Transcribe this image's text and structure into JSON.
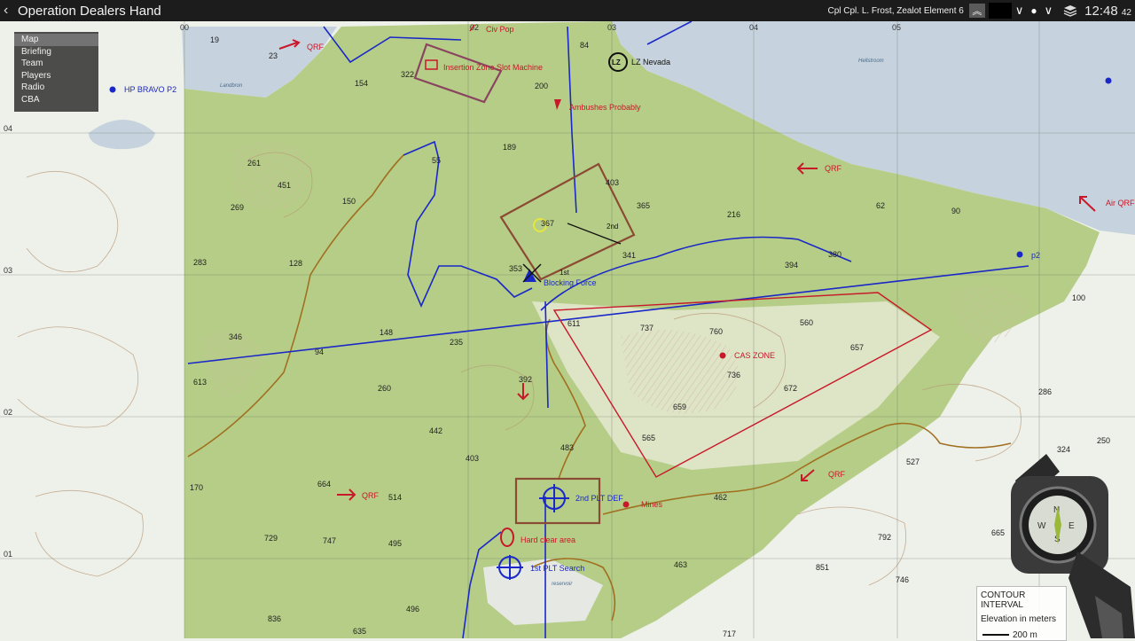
{
  "header": {
    "title": "Operation Dealers Hand",
    "player": "Cpl Cpl. L. Frost, Zealot Element 6",
    "time_main": "12:48",
    "time_sec": "42"
  },
  "menu": {
    "items": [
      "Map",
      "Briefing",
      "Team",
      "Players",
      "Radio",
      "CBA"
    ],
    "selected": "Map"
  },
  "legend": {
    "title": "CONTOUR INTERVAL",
    "subtitle": "Elevation in meters",
    "scale": "200 m"
  },
  "grid": {
    "top": [
      "00",
      "02",
      "03",
      "04",
      "05"
    ],
    "left": [
      "04",
      "03",
      "02",
      "01"
    ]
  },
  "markers": {
    "qrf": "QRF",
    "air_qrf": "Air QRF",
    "hp_bravo": "HP BRAVO P2",
    "p2": "p2",
    "lz_nevada": "LZ Nevada",
    "lz_label": "LZ",
    "insertion": "Insertion Zone Slot Machine",
    "ambushes": "Ambushes Probably",
    "blocking": "Blocking Force",
    "first": "1st",
    "second": "2nd",
    "cas_zone": "CAS ZONE",
    "second_plt_def": "2nd PLT DEF",
    "mines": "Mines",
    "hard_clear": "Hard clear area",
    "first_plt_search": "1st PLT Search",
    "civ_pop": "Civ Pop"
  },
  "elevations": [
    "19",
    "23",
    "322",
    "154",
    "84",
    "200",
    "261",
    "451",
    "150",
    "55",
    "269",
    "283",
    "128",
    "189",
    "403",
    "365",
    "216",
    "62",
    "90",
    "367",
    "341",
    "394",
    "380",
    "100",
    "353",
    "346",
    "148",
    "235",
    "94",
    "611",
    "737",
    "760",
    "560",
    "657",
    "613",
    "260",
    "392",
    "736",
    "672",
    "659",
    "286",
    "442",
    "565",
    "483",
    "403",
    "324",
    "250",
    "170",
    "664",
    "514",
    "462",
    "527",
    "495",
    "729",
    "747",
    "792",
    "665",
    "463",
    "851",
    "746",
    "836",
    "496",
    "635",
    "717"
  ],
  "water_labels": [
    "Hellstroom",
    "reservoir",
    "Landbron"
  ],
  "colors": {
    "land": "#b5cd86",
    "lowland": "#eef0ea",
    "water": "#c6d3de",
    "contour": "#b89876",
    "blue_line": "#1a28c8",
    "red_line": "#c8182a",
    "road": "#a07020"
  },
  "icons": [
    "back-icon",
    "chevron-up-icon",
    "chevron-down-icon",
    "dot-icon",
    "layers-icon",
    "compass-icon"
  ]
}
